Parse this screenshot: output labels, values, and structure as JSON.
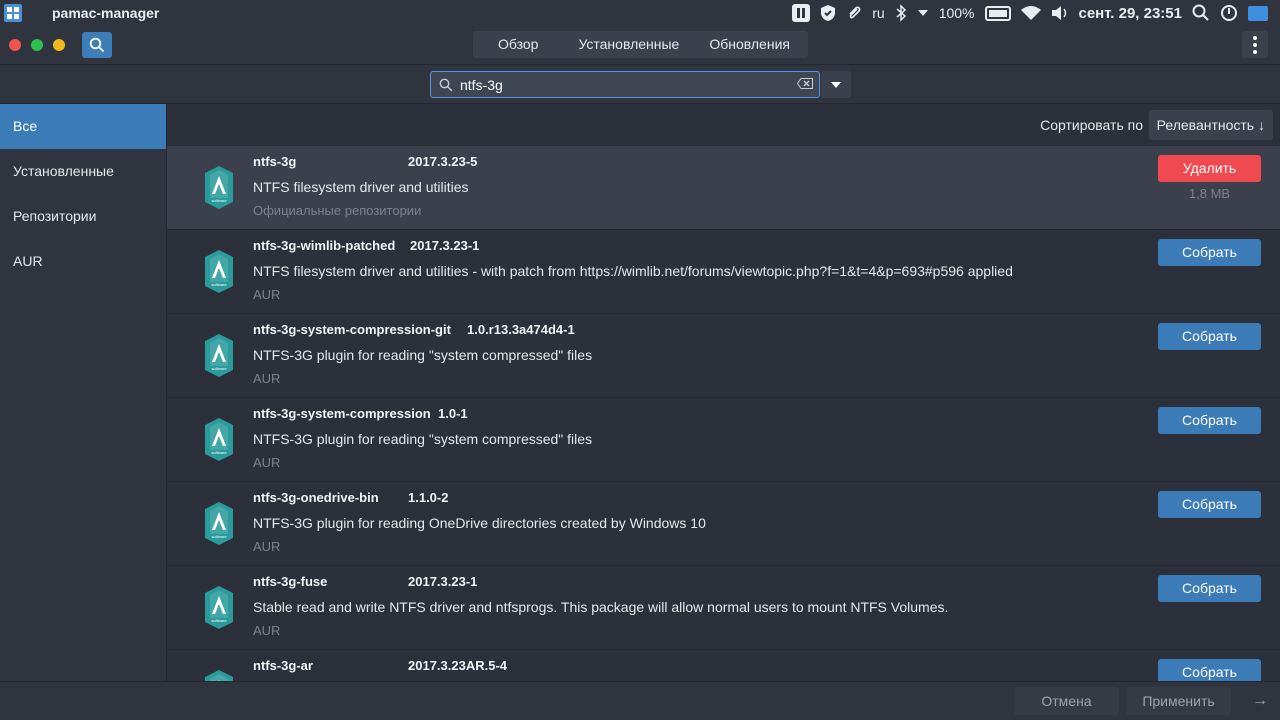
{
  "panel": {
    "app_name": "pamac-manager",
    "keyboard_layout": "ru",
    "battery": "100%",
    "clock": "сент. 29, 23:51"
  },
  "header": {
    "tabs": [
      "Обзор",
      "Установленные",
      "Обновления"
    ]
  },
  "search": {
    "value": "ntfs-3g"
  },
  "sidebar": {
    "items": [
      {
        "label": "Все",
        "active": true
      },
      {
        "label": "Установленные",
        "active": false
      },
      {
        "label": "Репозитории",
        "active": false
      },
      {
        "label": "AUR",
        "active": false
      }
    ]
  },
  "sort": {
    "label": "Сортировать по",
    "value": "Релевантность"
  },
  "packages": [
    {
      "name": "ntfs-3g",
      "version": "2017.3.23-5",
      "description": "NTFS filesystem driver and utilities",
      "repo": "Официальные репозитории",
      "action": "Удалить",
      "size": "1,8 MB"
    },
    {
      "name": "ntfs-3g-wimlib-patched",
      "version": "2017.3.23-1",
      "description": "NTFS filesystem driver and utilities - with patch from https://wimlib.net/forums/viewtopic.php?f=1&t=4&p=693#p596 applied",
      "repo": "AUR",
      "action": "Собрать"
    },
    {
      "name": "ntfs-3g-system-compression-git",
      "version": "1.0.r13.3a474d4-1",
      "description": "NTFS-3G plugin for reading \"system compressed\" files",
      "repo": "AUR",
      "action": "Собрать"
    },
    {
      "name": "ntfs-3g-system-compression",
      "version": "1.0-1",
      "description": "NTFS-3G plugin for reading \"system compressed\" files",
      "repo": "AUR",
      "action": "Собрать"
    },
    {
      "name": "ntfs-3g-onedrive-bin",
      "version": "1.1.0-2",
      "description": "NTFS-3G plugin for reading OneDrive directories created by Windows 10",
      "repo": "AUR",
      "action": "Собрать"
    },
    {
      "name": "ntfs-3g-fuse",
      "version": "2017.3.23-1",
      "description": "Stable read and write NTFS driver and ntfsprogs. This package will allow normal users to mount NTFS Volumes.",
      "repo": "AUR",
      "action": "Собрать"
    },
    {
      "name": "ntfs-3g-ar",
      "version": "2017.3.23AR.5-4",
      "description": "",
      "repo": "",
      "action": "Собрать"
    }
  ],
  "icon_label": "software",
  "footer": {
    "cancel": "Отмена",
    "apply": "Применить"
  },
  "colors": {
    "accent": "#3b7bb8",
    "remove": "#f04a50",
    "window_close": "#f0544f",
    "window_max": "#2ebf4f",
    "window_min": "#f0b91e"
  }
}
